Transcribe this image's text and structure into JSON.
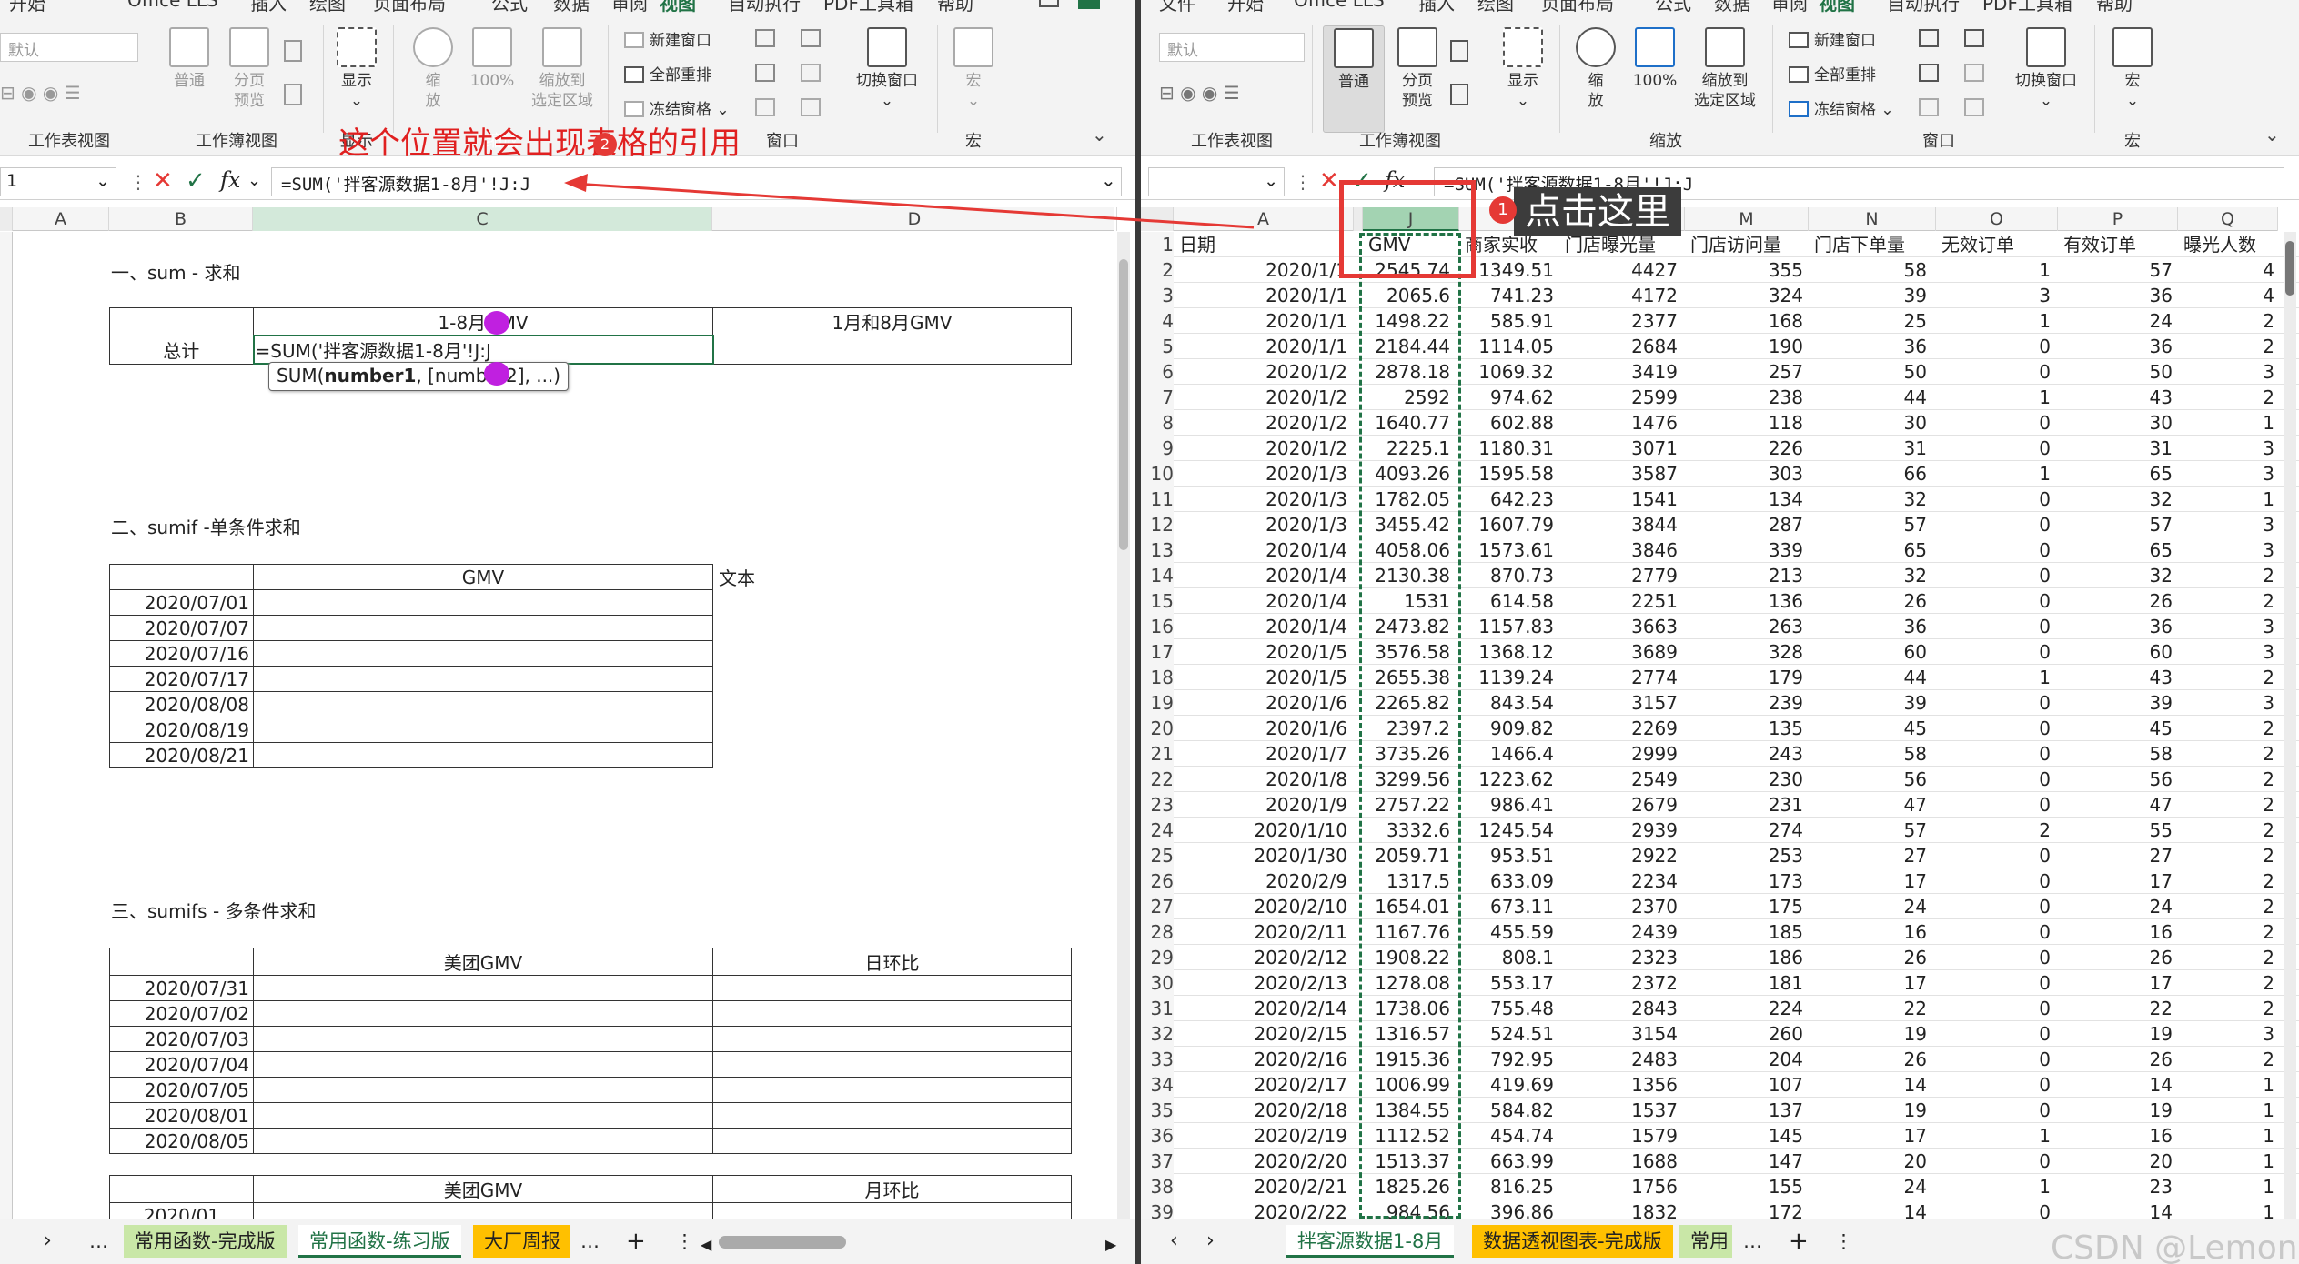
{
  "left": {
    "ribbon": {
      "tabs": [
        "文件",
        "开始",
        "Office LLS",
        "插入",
        "绘图",
        "页面布局",
        "公式",
        "数据",
        "审阅",
        "视图",
        "自动执行",
        "PDF工具箱",
        "帮助"
      ],
      "view_combo": "默认",
      "groups": [
        "工作表视图",
        "工作簿视图",
        "显示",
        "缩放",
        "窗口",
        "宏"
      ],
      "btn_normal": "普通",
      "btn_pagebreak_1": "分页",
      "btn_pagebreak_2": "预览",
      "btn_show": "显示",
      "btn_zoom_1": "缩",
      "btn_zoom_2": "放",
      "btn_100": "100%",
      "btn_zoomsel_1": "缩放到",
      "btn_zoomsel_2": "选定区域",
      "btn_newwin": "新建窗口",
      "btn_arrange": "全部重排",
      "btn_freeze": "冻结窗格",
      "btn_switch": "切换窗口",
      "btn_macro": "宏"
    },
    "namebox": "1",
    "formula": "=SUM('拌客源数据1-8月'!J:J",
    "columns": [
      "A",
      "B",
      "C",
      "D"
    ],
    "s1_title": "一、sum - 求和",
    "s1_h1": "1-8月GMV",
    "s1_h2": "1月和8月GMV",
    "s1_label": "总计",
    "s1_editing": "=SUM('拌客源数据1-8月'!J:J",
    "tooltip_fn": "SUM(",
    "tooltip_arg1": "number1",
    "tooltip_rest": ", [number2], ...)",
    "s2_title": "二、sumif -单条件求和",
    "s2_h": "GMV",
    "s2_text": "文本",
    "s2_dates": [
      "2020/07/01",
      "2020/07/07",
      "2020/07/16",
      "2020/07/17",
      "2020/08/08",
      "2020/08/19",
      "2020/08/21"
    ],
    "s3_title": "三、sumifs - 多条件求和",
    "s3_h1": "美团GMV",
    "s3_h2": "日环比",
    "s3_dates": [
      "2020/07/31",
      "2020/07/02",
      "2020/07/03",
      "2020/07/04",
      "2020/07/05",
      "2020/08/01",
      "2020/08/05"
    ],
    "s4_h1": "美团GMV",
    "s4_h2": "月环比",
    "s4_date": "2020/01",
    "sheet_tabs": [
      "常用函数-完成版",
      "常用函数-练习版",
      "大厂周报"
    ],
    "callout": "这个位置就会出现表格的引用",
    "badge": "2"
  },
  "right": {
    "ribbon": {
      "tabs": [
        "文件",
        "开始",
        "Office LLS",
        "插入",
        "绘图",
        "页面布局",
        "公式",
        "数据",
        "审阅",
        "视图",
        "自动执行",
        "PDF工具箱",
        "帮助"
      ],
      "view_combo": "默认",
      "groups": [
        "工作表视图",
        "工作簿视图",
        "缩放",
        "窗口",
        "宏"
      ],
      "btn_normal": "普通",
      "btn_pagebreak_1": "分页",
      "btn_pagebreak_2": "预览",
      "btn_show": "显示",
      "btn_zoom_1": "缩",
      "btn_zoom_2": "放",
      "btn_100": "100%",
      "btn_zoomsel_1": "缩放到",
      "btn_zoomsel_2": "选定区域",
      "btn_newwin": "新建窗口",
      "btn_arrange": "全部重排",
      "btn_freeze": "冻结窗格",
      "btn_switch": "切换窗口",
      "btn_macro": "宏"
    },
    "formula": "=SUM('拌客源数据1-8月'!J:J",
    "columns": [
      "A",
      "J",
      "L",
      "M",
      "N",
      "O",
      "P",
      "Q"
    ],
    "headers": [
      "日期",
      "GMV",
      "商家实收",
      "门店曝光量",
      "门店访问量",
      "门店下单量",
      "无效订单",
      "有效订单",
      "曝光人数"
    ],
    "rows": [
      [
        "2020/1/1",
        "2545.74",
        "1349.51",
        "4427",
        "355",
        "58",
        "1",
        "57",
        "4"
      ],
      [
        "2020/1/1",
        "2065.6",
        "741.23",
        "4172",
        "324",
        "39",
        "3",
        "36",
        "4"
      ],
      [
        "2020/1/1",
        "1498.22",
        "585.91",
        "2377",
        "168",
        "25",
        "1",
        "24",
        "2"
      ],
      [
        "2020/1/1",
        "2184.44",
        "1114.05",
        "2684",
        "190",
        "36",
        "0",
        "36",
        "2"
      ],
      [
        "2020/1/2",
        "2878.18",
        "1069.32",
        "3419",
        "257",
        "50",
        "0",
        "50",
        "3"
      ],
      [
        "2020/1/2",
        "2592",
        "974.62",
        "2599",
        "238",
        "44",
        "1",
        "43",
        "2"
      ],
      [
        "2020/1/2",
        "1640.77",
        "602.88",
        "1476",
        "118",
        "30",
        "0",
        "30",
        "1"
      ],
      [
        "2020/1/2",
        "2225.1",
        "1180.31",
        "3071",
        "226",
        "31",
        "0",
        "31",
        "3"
      ],
      [
        "2020/1/3",
        "4093.26",
        "1595.58",
        "3587",
        "303",
        "66",
        "1",
        "65",
        "3"
      ],
      [
        "2020/1/3",
        "1782.05",
        "642.23",
        "1541",
        "134",
        "32",
        "0",
        "32",
        "1"
      ],
      [
        "2020/1/3",
        "3455.42",
        "1607.79",
        "3844",
        "287",
        "57",
        "0",
        "57",
        "3"
      ],
      [
        "2020/1/4",
        "4058.06",
        "1573.61",
        "3846",
        "339",
        "65",
        "0",
        "65",
        "3"
      ],
      [
        "2020/1/4",
        "2130.38",
        "870.73",
        "2779",
        "213",
        "32",
        "0",
        "32",
        "2"
      ],
      [
        "2020/1/4",
        "1531",
        "614.58",
        "2251",
        "136",
        "26",
        "0",
        "26",
        "2"
      ],
      [
        "2020/1/4",
        "2473.82",
        "1157.83",
        "3663",
        "263",
        "36",
        "0",
        "36",
        "3"
      ],
      [
        "2020/1/5",
        "3576.58",
        "1368.12",
        "3689",
        "328",
        "60",
        "0",
        "60",
        "3"
      ],
      [
        "2020/1/5",
        "2655.38",
        "1139.24",
        "2774",
        "179",
        "44",
        "1",
        "43",
        "2"
      ],
      [
        "2020/1/6",
        "2265.82",
        "843.54",
        "3157",
        "239",
        "39",
        "0",
        "39",
        "3"
      ],
      [
        "2020/1/6",
        "2397.2",
        "909.82",
        "2269",
        "135",
        "45",
        "0",
        "45",
        "2"
      ],
      [
        "2020/1/7",
        "3735.26",
        "1466.4",
        "2999",
        "243",
        "58",
        "0",
        "58",
        "2"
      ],
      [
        "2020/1/8",
        "3299.56",
        "1223.62",
        "2549",
        "230",
        "56",
        "0",
        "56",
        "2"
      ],
      [
        "2020/1/9",
        "2757.22",
        "986.41",
        "2679",
        "231",
        "47",
        "0",
        "47",
        "2"
      ],
      [
        "2020/1/10",
        "3332.6",
        "1245.54",
        "2939",
        "274",
        "57",
        "2",
        "55",
        "2"
      ],
      [
        "2020/1/30",
        "2059.71",
        "953.51",
        "2922",
        "253",
        "27",
        "0",
        "27",
        "2"
      ],
      [
        "2020/2/9",
        "1317.5",
        "633.09",
        "2234",
        "173",
        "17",
        "0",
        "17",
        "2"
      ],
      [
        "2020/2/10",
        "1654.01",
        "673.11",
        "2370",
        "175",
        "24",
        "0",
        "24",
        "2"
      ],
      [
        "2020/2/11",
        "1167.76",
        "455.59",
        "2439",
        "185",
        "16",
        "0",
        "16",
        "2"
      ],
      [
        "2020/2/12",
        "1908.22",
        "808.1",
        "2323",
        "186",
        "26",
        "0",
        "26",
        "2"
      ],
      [
        "2020/2/13",
        "1278.08",
        "553.17",
        "2372",
        "181",
        "17",
        "0",
        "17",
        "2"
      ],
      [
        "2020/2/14",
        "1738.06",
        "755.48",
        "2843",
        "224",
        "22",
        "0",
        "22",
        "2"
      ],
      [
        "2020/2/15",
        "1316.57",
        "524.51",
        "3154",
        "260",
        "19",
        "0",
        "19",
        "3"
      ],
      [
        "2020/2/16",
        "1915.36",
        "792.95",
        "2483",
        "204",
        "26",
        "0",
        "26",
        "2"
      ],
      [
        "2020/2/17",
        "1006.99",
        "419.69",
        "1356",
        "107",
        "14",
        "0",
        "14",
        "1"
      ],
      [
        "2020/2/18",
        "1384.55",
        "584.82",
        "1537",
        "137",
        "19",
        "0",
        "19",
        "1"
      ],
      [
        "2020/2/19",
        "1112.52",
        "454.74",
        "1579",
        "145",
        "17",
        "1",
        "16",
        "1"
      ],
      [
        "2020/2/20",
        "1513.37",
        "663.99",
        "1688",
        "147",
        "20",
        "0",
        "20",
        "1"
      ],
      [
        "2020/2/21",
        "1825.26",
        "816.25",
        "1756",
        "155",
        "24",
        "1",
        "23",
        "1"
      ],
      [
        "2020/2/22",
        "984.56",
        "396.86",
        "1832",
        "172",
        "14",
        "0",
        "14",
        "1"
      ]
    ],
    "sheet_tabs": [
      "拌客源数据1-8月",
      "数据透视图表-完成版",
      "常用"
    ],
    "callout": "点击这里",
    "badge": "1",
    "watermark": "CSDN @Lemon爱吃苹果"
  },
  "colors": {
    "accent": "#217346",
    "red": "#e53935",
    "purple": "#c020e0",
    "tab_orange": "#ffc000",
    "tab_green": "#c9e7a7"
  }
}
